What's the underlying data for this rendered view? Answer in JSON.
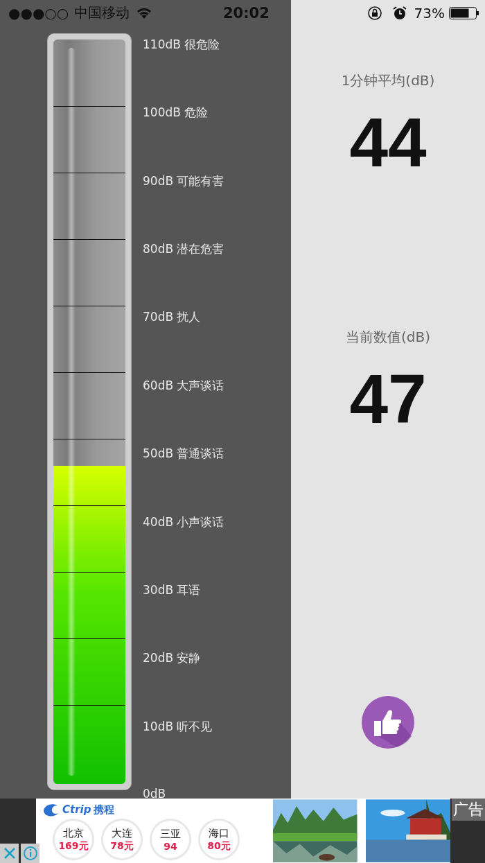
{
  "status_bar": {
    "signal": "●●●○○",
    "carrier": "中国移动",
    "time": "20:02",
    "battery": "73%"
  },
  "meter": {
    "level": 0.427,
    "scale": [
      "110dB 很危险",
      "100dB 危险",
      "90dB 可能有害",
      "80dB 潜在危害",
      "70dB 扰人",
      "60dB 大声谈话",
      "50dB 普通谈话",
      "40dB 小声谈话",
      "30dB 耳语",
      "20dB 安静",
      "10dB 听不见",
      "0dB"
    ]
  },
  "readings": [
    {
      "label": "1分钟平均(dB)",
      "value": "44"
    },
    {
      "label": "当前数值(dB)",
      "value": "47"
    }
  ],
  "ad": {
    "brand_latin": "Ctrip",
    "brand": "携程",
    "cities": [
      {
        "name": "北京",
        "price": "169元"
      },
      {
        "name": "大连",
        "price": "78元"
      },
      {
        "name": "三亚",
        "price": "94"
      },
      {
        "name": "海口",
        "price": "80元"
      }
    ],
    "tag": "广告"
  }
}
